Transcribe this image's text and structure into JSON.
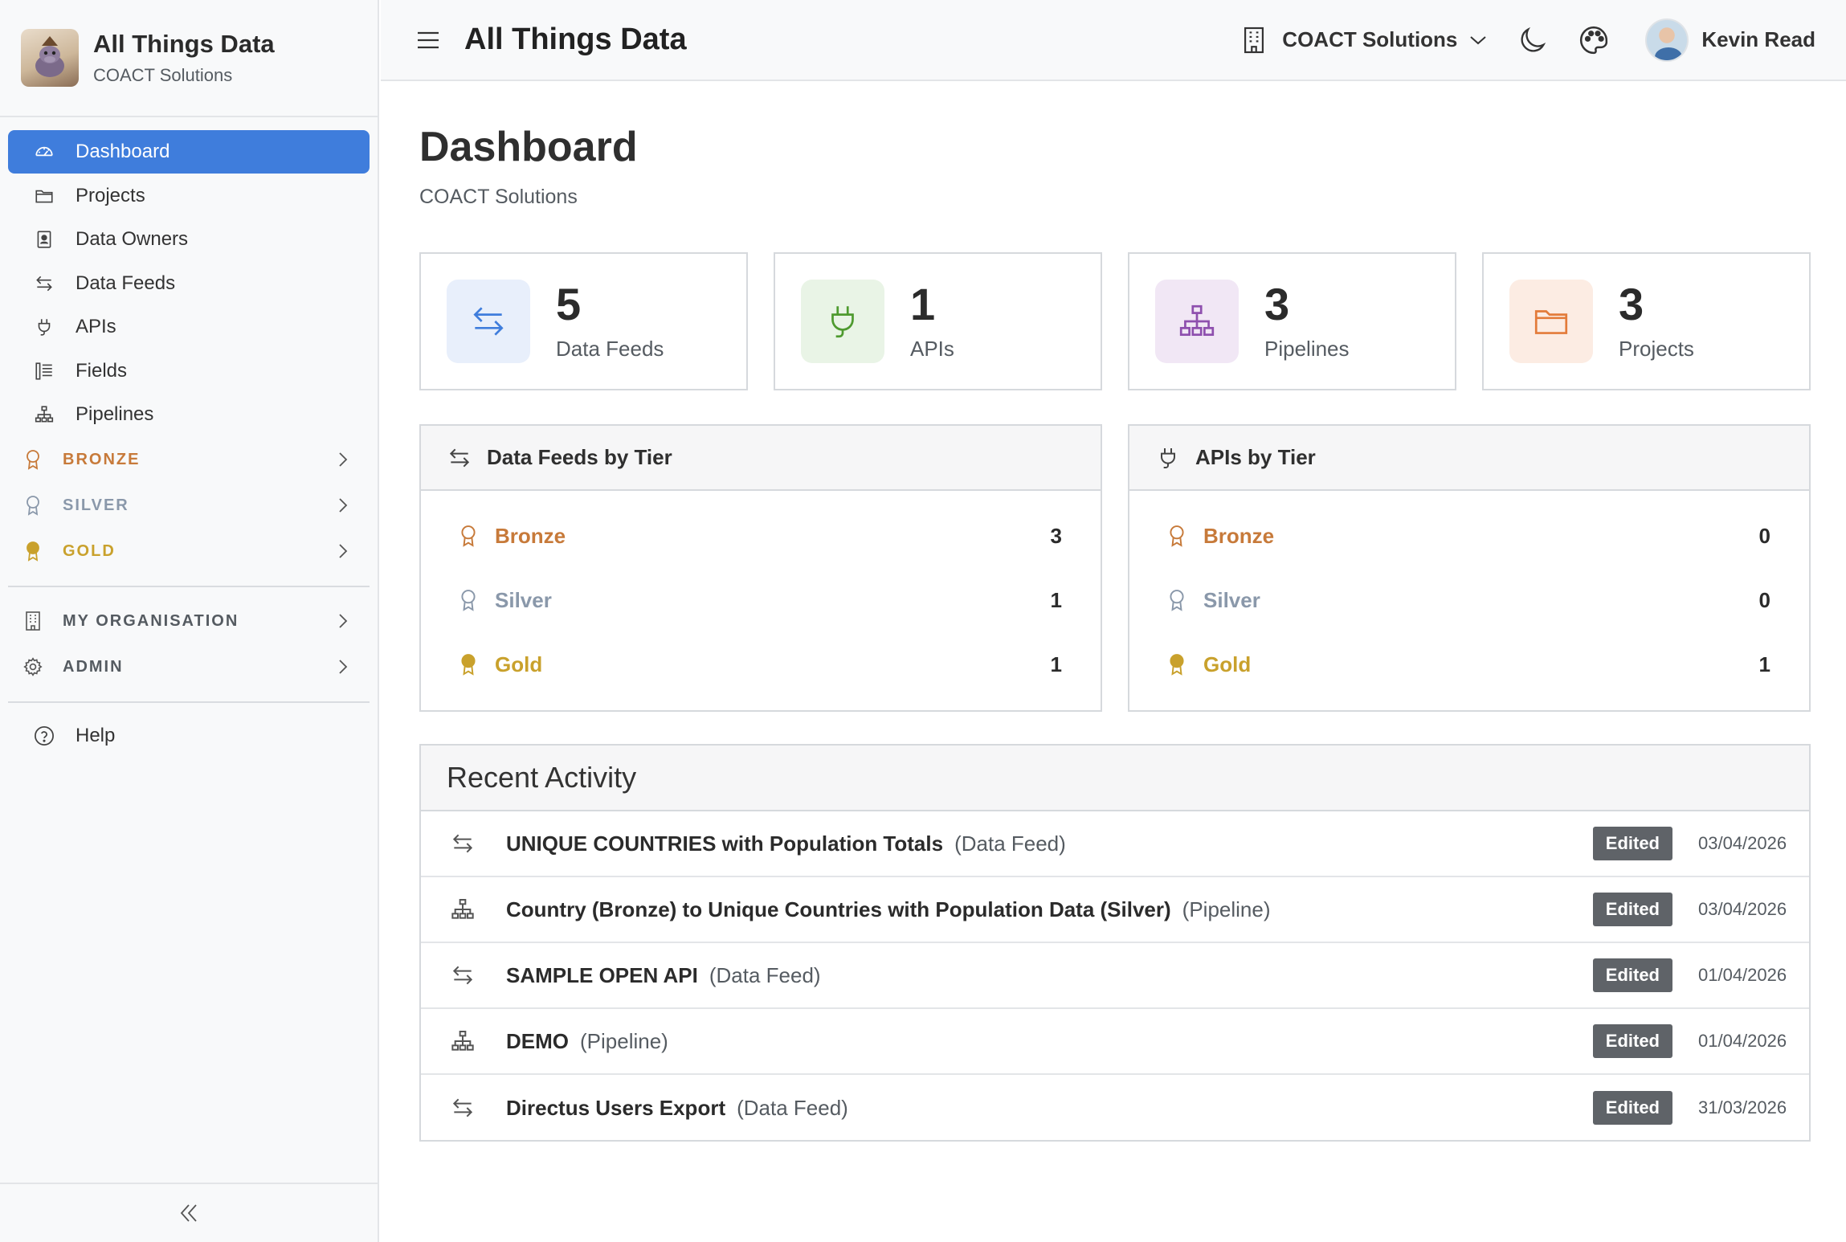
{
  "app": {
    "name": "All Things Data",
    "org": "COACT Solutions"
  },
  "sidebar": {
    "items": [
      {
        "label": "Dashboard",
        "icon": "gauge-icon",
        "active": true
      },
      {
        "label": "Projects",
        "icon": "folder-icon"
      },
      {
        "label": "Data Owners",
        "icon": "contact-book-icon"
      },
      {
        "label": "Data Feeds",
        "icon": "arrows-exchange-icon"
      },
      {
        "label": "APIs",
        "icon": "plug-icon"
      },
      {
        "label": "Fields",
        "icon": "fields-list-icon"
      },
      {
        "label": "Pipelines",
        "icon": "diagram-icon"
      }
    ],
    "tiers": [
      {
        "label": "BRONZE",
        "color": "#c77a3a"
      },
      {
        "label": "SILVER",
        "color": "#8a98aa"
      },
      {
        "label": "GOLD",
        "color": "#c9a12c"
      }
    ],
    "sections": [
      {
        "label": "MY ORGANISATION",
        "icon": "building-icon"
      },
      {
        "label": "ADMIN",
        "icon": "gear-icon"
      }
    ],
    "help": "Help"
  },
  "topbar": {
    "title": "All Things Data",
    "org_selector": "COACT Solutions",
    "user_name": "Kevin Read"
  },
  "dashboard": {
    "title": "Dashboard",
    "subtitle": "COACT Solutions"
  },
  "stats": [
    {
      "value": "5",
      "label": "Data Feeds",
      "tile_bg": "#e8effb",
      "icon_color": "#3f7ddc"
    },
    {
      "value": "1",
      "label": "APIs",
      "tile_bg": "#e9f4e6",
      "icon_color": "#4e9a2f"
    },
    {
      "value": "3",
      "label": "Pipelines",
      "tile_bg": "#f1e7f5",
      "icon_color": "#8e4fae"
    },
    {
      "value": "3",
      "label": "Projects",
      "tile_bg": "#fcece3",
      "icon_color": "#e37b3a"
    }
  ],
  "feeds_by_tier": {
    "title": "Data Feeds by Tier",
    "rows": [
      {
        "label": "Bronze",
        "count": "3"
      },
      {
        "label": "Silver",
        "count": "1"
      },
      {
        "label": "Gold",
        "count": "1"
      }
    ]
  },
  "apis_by_tier": {
    "title": "APIs by Tier",
    "rows": [
      {
        "label": "Bronze",
        "count": "0"
      },
      {
        "label": "Silver",
        "count": "0"
      },
      {
        "label": "Gold",
        "count": "1"
      }
    ]
  },
  "activity": {
    "title": "Recent Activity",
    "rows": [
      {
        "name": "UNIQUE COUNTRIES with Population Totals",
        "type": "(Data Feed)",
        "badge": "Edited",
        "date": "03/04/2026",
        "icon": "arrows-exchange-icon"
      },
      {
        "name": "Country (Bronze) to Unique Countries with Population Data (Silver)",
        "type": "(Pipeline)",
        "badge": "Edited",
        "date": "03/04/2026",
        "icon": "diagram-icon"
      },
      {
        "name": "SAMPLE OPEN API",
        "type": "(Data Feed)",
        "badge": "Edited",
        "date": "01/04/2026",
        "icon": "arrows-exchange-icon"
      },
      {
        "name": "DEMO",
        "type": "(Pipeline)",
        "badge": "Edited",
        "date": "01/04/2026",
        "icon": "diagram-icon"
      },
      {
        "name": "Directus Users Export",
        "type": "(Data Feed)",
        "badge": "Edited",
        "date": "31/03/2026",
        "icon": "arrows-exchange-icon"
      }
    ]
  }
}
